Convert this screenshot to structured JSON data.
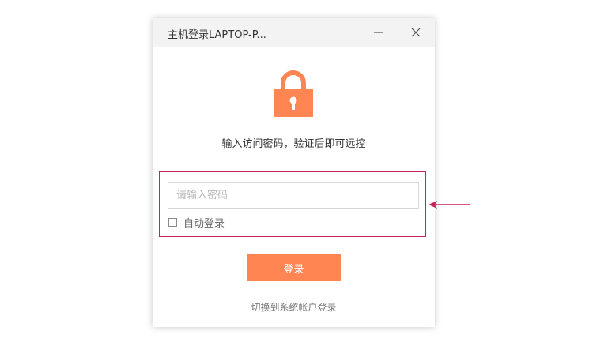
{
  "window": {
    "title": "主机登录LAPTOP-P...",
    "minimize_icon": "minimize-icon",
    "close_icon": "close-icon"
  },
  "lock": {
    "icon": "lock-icon",
    "color": "#ff8552"
  },
  "subtitle": "输入访问密码，验证后即可远控",
  "password": {
    "placeholder": "请输入密码",
    "value": ""
  },
  "auto_login": {
    "label": "自动登录",
    "checked": false
  },
  "login_button": {
    "label": "登录",
    "color": "#ff8552"
  },
  "switch_link": "切换到系统帐户登录",
  "annotation": {
    "highlight_color": "#c8215a",
    "arrow_icon": "arrow-left-icon"
  }
}
